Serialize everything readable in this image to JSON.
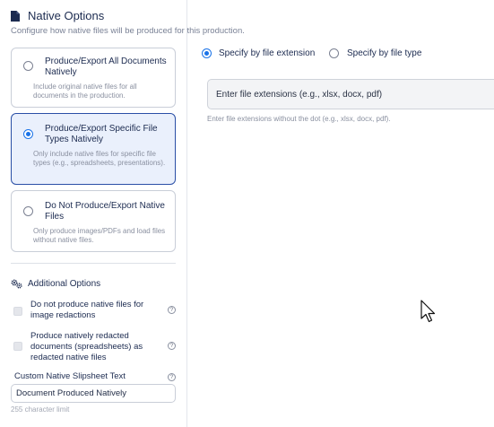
{
  "header": {
    "title": "Native Options",
    "subtitle": "Configure how native files will be produced for this production."
  },
  "options": [
    {
      "title": "Produce/Export All Documents Natively",
      "description": "Include original native files for all documents in the production.",
      "selected": false
    },
    {
      "title": "Produce/Export Specific File Types Natively",
      "description": "Only include native files for specific file types (e.g., spreadsheets, presentations).",
      "selected": true
    },
    {
      "title": "Do Not Produce/Export Native Files",
      "description": "Only produce images/PDFs and load files without native files.",
      "selected": false
    }
  ],
  "additional": {
    "label": "Additional Options",
    "items": [
      {
        "label": "Do not produce native files for image redactions",
        "checked": false,
        "help": "?"
      },
      {
        "label": "Produce natively redacted documents (spreadsheets) as redacted native files",
        "checked": false,
        "help": "?"
      }
    ],
    "slipsheet_label": "Custom Native Slipsheet Text",
    "slipsheet_help": "?",
    "slipsheet_value": "Document Produced Natively",
    "char_limit": "255 character limit"
  },
  "specify": {
    "by_extension_label": "Specify by file extension",
    "by_type_label": "Specify by file type",
    "selected": "extension",
    "input_placeholder": "Enter file extensions (e.g., xlsx, docx, pdf)",
    "hint": "Enter file extensions without the dot (e.g., xlsx, docx, pdf)."
  },
  "colors": {
    "accent": "#1a73e8",
    "selected_border": "#2a4fa6",
    "selected_bg": "#eaf0fc",
    "title": "#1c2b50",
    "muted": "#8a90a0"
  },
  "icons": [
    "document-icon",
    "gears-icon",
    "help-icon",
    "mouse-cursor-icon"
  ]
}
